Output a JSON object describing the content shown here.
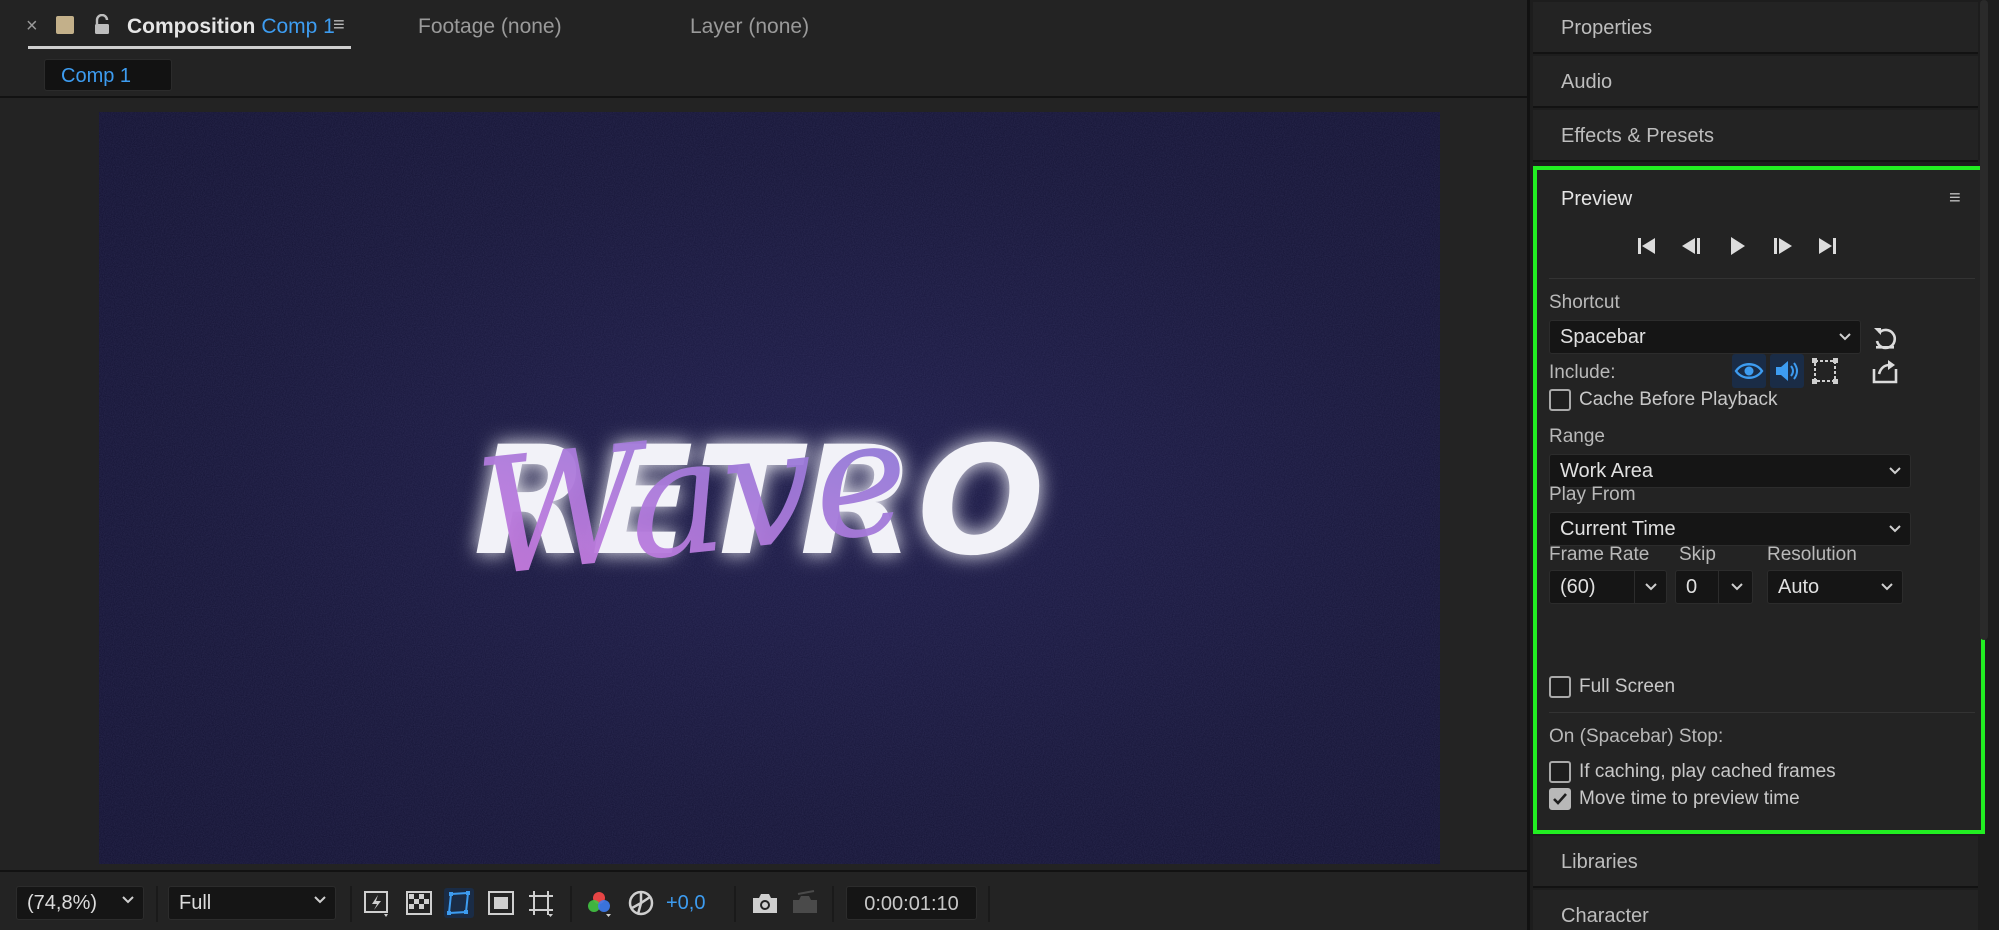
{
  "composition_panel": {
    "tab_label": "Composition",
    "comp_name": "Comp 1",
    "footage_tab": "Footage (none)",
    "layer_tab": "Layer (none)",
    "comp_chip": "Comp 1"
  },
  "canvas": {
    "title_text": "RETRO",
    "script_text": "Wave"
  },
  "viewer_toolbar": {
    "zoom": "(74,8%)",
    "resolution": "Full",
    "exposure": "+0,0",
    "timecode": "0:00:01:10"
  },
  "right_panels": {
    "properties": "Properties",
    "audio": "Audio",
    "effects_presets": "Effects & Presets",
    "libraries": "Libraries",
    "character": "Character"
  },
  "preview": {
    "title": "Preview",
    "shortcut_label": "Shortcut",
    "shortcut_value": "Spacebar",
    "include_label": "Include:",
    "cache_before_playback": "Cache Before Playback",
    "range_label": "Range",
    "range_value": "Work Area",
    "play_from_label": "Play From",
    "play_from_value": "Current Time",
    "frame_rate_label": "Frame Rate",
    "frame_rate_value": "(60)",
    "skip_label": "Skip",
    "skip_value": "0",
    "resolution_label": "Resolution",
    "resolution_value": "Auto",
    "full_screen": "Full Screen",
    "stop_label": "On (Spacebar) Stop:",
    "if_caching": "If caching, play cached frames",
    "move_time": "Move time to preview time",
    "checked": {
      "cache_before_playback": false,
      "full_screen": false,
      "if_caching": false,
      "move_time": true
    }
  },
  "colors": {
    "accent_blue": "#3d9cf0",
    "highlight_green": "#22ee22",
    "canvas_bg": "#151436",
    "script_pink": "#d07be0",
    "script_violet": "#8579d6"
  }
}
